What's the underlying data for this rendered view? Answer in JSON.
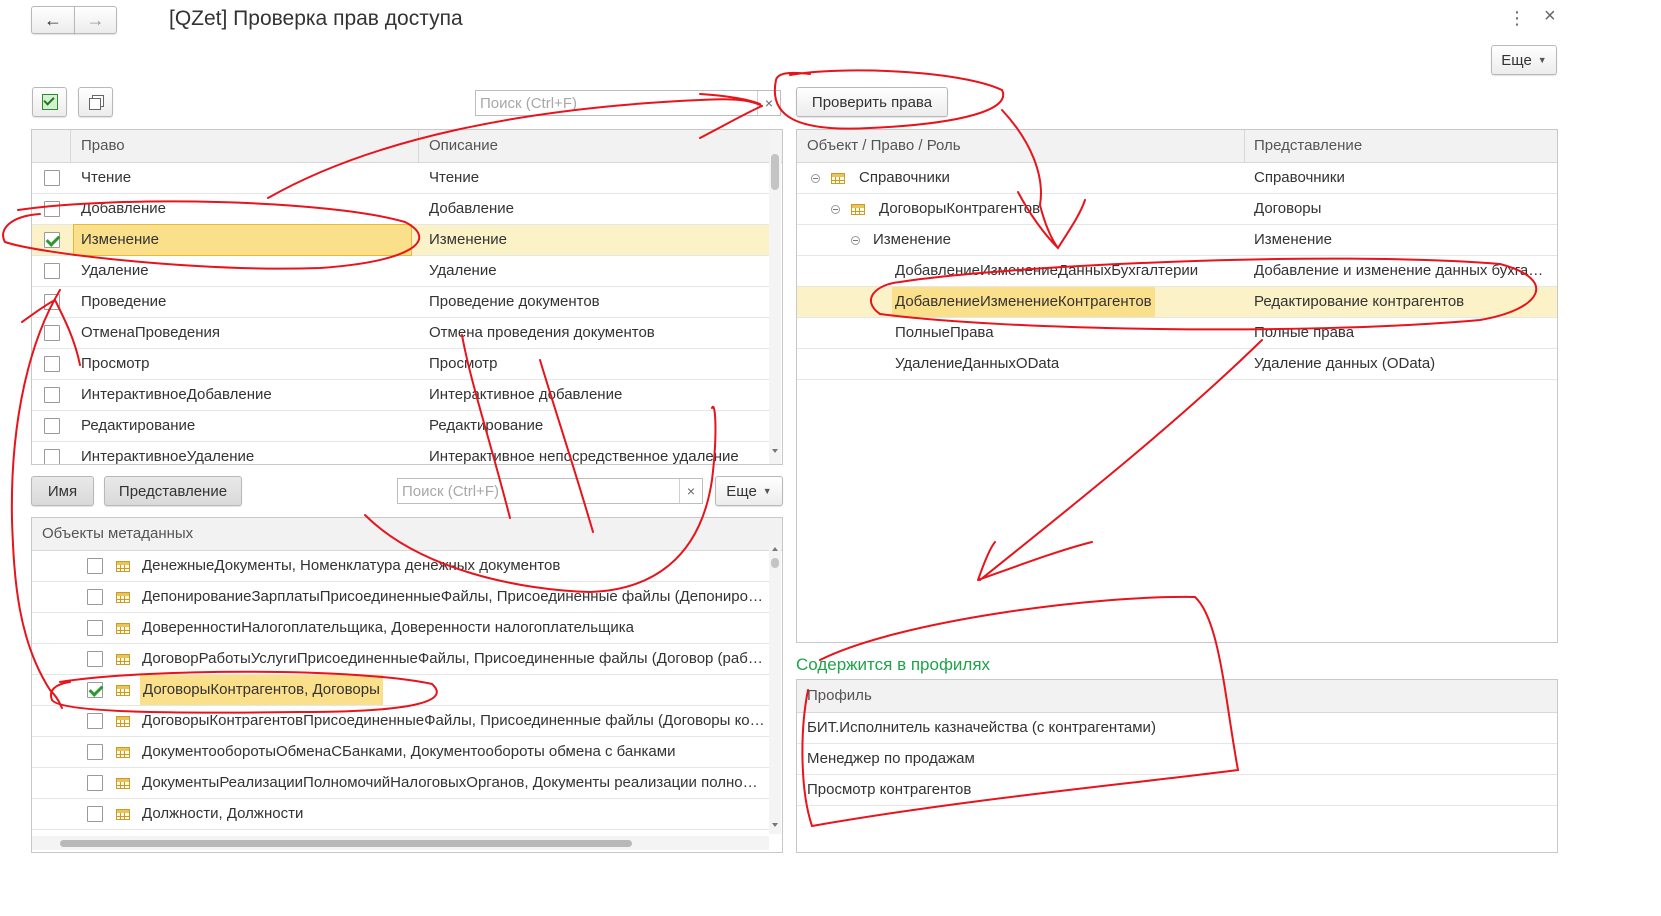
{
  "window": {
    "title": "[QZet] Проверка прав доступа",
    "more_button": "Еще"
  },
  "rights": {
    "search_placeholder": "Поиск (Ctrl+F)",
    "columns": [
      "Право",
      "Описание"
    ],
    "rows": [
      {
        "name": "Чтение",
        "desc": "Чтение",
        "checked": false
      },
      {
        "name": "Добавление",
        "desc": "Добавление",
        "checked": false
      },
      {
        "name": "Изменение",
        "desc": "Изменение",
        "checked": true
      },
      {
        "name": "Удаление",
        "desc": "Удаление",
        "checked": false
      },
      {
        "name": "Проведение",
        "desc": "Проведение документов",
        "checked": false
      },
      {
        "name": "ОтменаПроведения",
        "desc": "Отмена проведения документов",
        "checked": false
      },
      {
        "name": "Просмотр",
        "desc": "Просмотр",
        "checked": false
      },
      {
        "name": "ИнтерактивноеДобавление",
        "desc": "Интерактивное добавление",
        "checked": false
      },
      {
        "name": "Редактирование",
        "desc": "Редактирование",
        "checked": false
      },
      {
        "name": "ИнтерактивноеУдаление",
        "desc": "Интерактивное непосредственное удаление",
        "checked": false
      }
    ]
  },
  "objects": {
    "name_button": "Имя",
    "repr_button": "Представление",
    "search_placeholder": "Поиск (Ctrl+F)",
    "more_button": "Еще",
    "column": "Объекты метаданных",
    "rows": [
      {
        "label": "ДенежныеДокументы, Номенклатура денежных документов",
        "checked": false
      },
      {
        "label": "ДепонированиеЗарплатыПрисоединенныеФайлы, Присоединенные файлы (Депонировани",
        "checked": false
      },
      {
        "label": "ДоверенностиНалогоплательщика, Доверенности налогоплательщика",
        "checked": false
      },
      {
        "label": "ДоговорРаботыУслугиПрисоединенныеФайлы, Присоединенные файлы (Договор (работы,",
        "checked": false
      },
      {
        "label": "ДоговорыКонтрагентов, Договоры",
        "checked": true
      },
      {
        "label": "ДоговорыКонтрагентовПрисоединенныеФайлы, Присоединенные файлы (Договоры контр",
        "checked": false
      },
      {
        "label": "ДокументооборотыОбменаСБанками, Документообороты обмена с банками",
        "checked": false
      },
      {
        "label": "ДокументыРеализацииПолномочийНалоговыхОрганов, Документы реализации полномочий",
        "checked": false
      },
      {
        "label": "Должности, Должности",
        "checked": false
      }
    ]
  },
  "check": {
    "button": "Проверить права",
    "columns": [
      "Объект / Право / Роль",
      "Представление"
    ],
    "rows": [
      {
        "name": "Справочники",
        "repr": "Справочники",
        "level": 0,
        "icon": "table-icon",
        "expand": true
      },
      {
        "name": "ДоговорыКонтрагентов",
        "repr": "Договоры",
        "level": 1,
        "icon": "table-icon",
        "expand": true
      },
      {
        "name": "Изменение",
        "repr": "Изменение",
        "level": 2,
        "icon": "",
        "expand": true
      },
      {
        "name": "ДобавлениеИзменениеДанныхБухгалтерии",
        "repr": "Добавление и изменение данных бухгалт…",
        "level": 3,
        "icon": "",
        "expand": false
      },
      {
        "name": "ДобавлениеИзменениеКонтрагентов",
        "repr": "Редактирование контрагентов",
        "level": 3,
        "icon": "",
        "expand": false,
        "selected": true
      },
      {
        "name": "ПолныеПрава",
        "repr": "Полные права",
        "level": 3,
        "icon": "",
        "expand": false
      },
      {
        "name": "УдалениеДанныхOData",
        "repr": "Удаление данных (OData)",
        "level": 3,
        "icon": "",
        "expand": false
      }
    ]
  },
  "profiles": {
    "title": "Содержится в профилях",
    "column": "Профиль",
    "rows": [
      "БИТ.Исполнитель казначейства (с контрагентами)",
      "Менеджер по продажам",
      "Просмотр контрагентов"
    ]
  },
  "colors": {
    "selection": "#fcf2c8",
    "annotation": "#e8131b",
    "section_title": "#1fa34a"
  }
}
